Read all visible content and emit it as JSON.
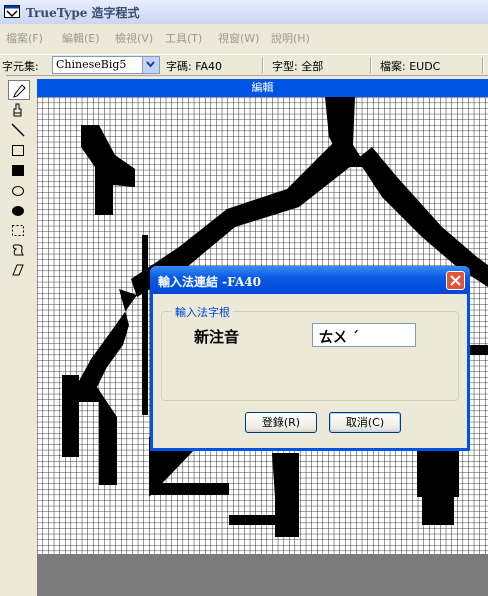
{
  "window": {
    "title": "TrueType 造字程式"
  },
  "menu": [
    "檔案(F)",
    "編輯(E)",
    "檢視(V)",
    "工具(T)",
    "視窗(W)",
    "說明(H)"
  ],
  "fieldbar": {
    "charset_label": "字元集:",
    "charset_value": "ChineseBig5",
    "code_label": "字碼: FA40",
    "font_label": "字型: 全部",
    "file_label": "檔案: EUDC"
  },
  "tools": [
    "pencil-icon",
    "brush-icon",
    "line-icon",
    "hollow-rectangle-icon",
    "filled-rectangle-icon",
    "hollow-ellipse-icon",
    "filled-ellipse-icon",
    "rectangular-select-icon",
    "freeform-select-icon",
    "eraser-icon"
  ],
  "editor": {
    "header": "編輯"
  },
  "dialog": {
    "title": "輸入法連結 -FA40",
    "group_label": "輸入法字根",
    "method_name": "新注音",
    "root_value": "ㄊㄨ ˊ",
    "register_label": "登錄(R)",
    "cancel_label": "取消(C)"
  },
  "colors": {
    "editor_header": "#0054e3",
    "glyph": "#000000",
    "dialog_frame": "#0054e3"
  }
}
